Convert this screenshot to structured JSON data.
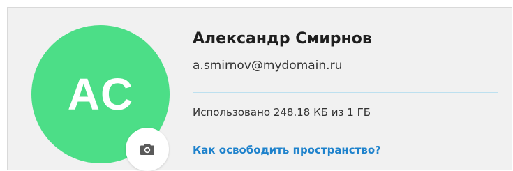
{
  "colors": {
    "avatar_bg": "#4cde87",
    "link": "#1e82cc"
  },
  "avatar": {
    "initials": "AC"
  },
  "camera_button": {
    "icon": "camera-icon"
  },
  "profile": {
    "name": "Александр Смирнов",
    "email": "a.smirnov@mydomain.ru"
  },
  "storage": {
    "usage_text": "Использовано 248.18 КБ из 1 ГБ",
    "free_space_link": "Как освободить пространство?"
  }
}
